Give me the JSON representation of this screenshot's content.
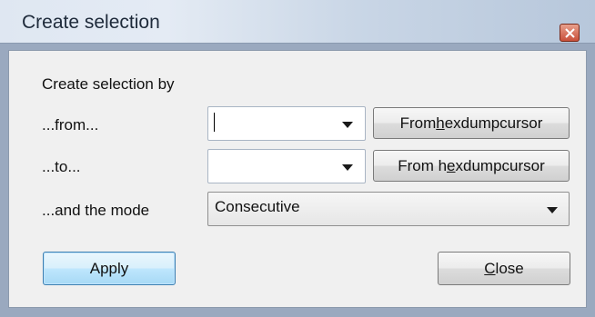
{
  "window": {
    "title": "Create selection",
    "close_icon": "close-icon"
  },
  "form": {
    "heading": "Create selection by",
    "from_label": "...from...",
    "to_label": "...to...",
    "mode_label": "...and the mode",
    "from_value": "",
    "to_value": "",
    "mode_value": "Consecutive",
    "from_button": {
      "pre": "From ",
      "accel": "h",
      "post": "exdumpcursor"
    },
    "to_button": {
      "pre": "From h",
      "accel": "e",
      "post": "xdumpcursor"
    }
  },
  "buttons": {
    "apply": "Apply",
    "close": {
      "pre": "",
      "accel": "C",
      "post": "lose"
    }
  },
  "colors": {
    "title_text": "#1e2a3a",
    "close_button": "#c9503a",
    "default_button_border": "#3c7fb1",
    "dialog_background": "#f0f0f0"
  }
}
